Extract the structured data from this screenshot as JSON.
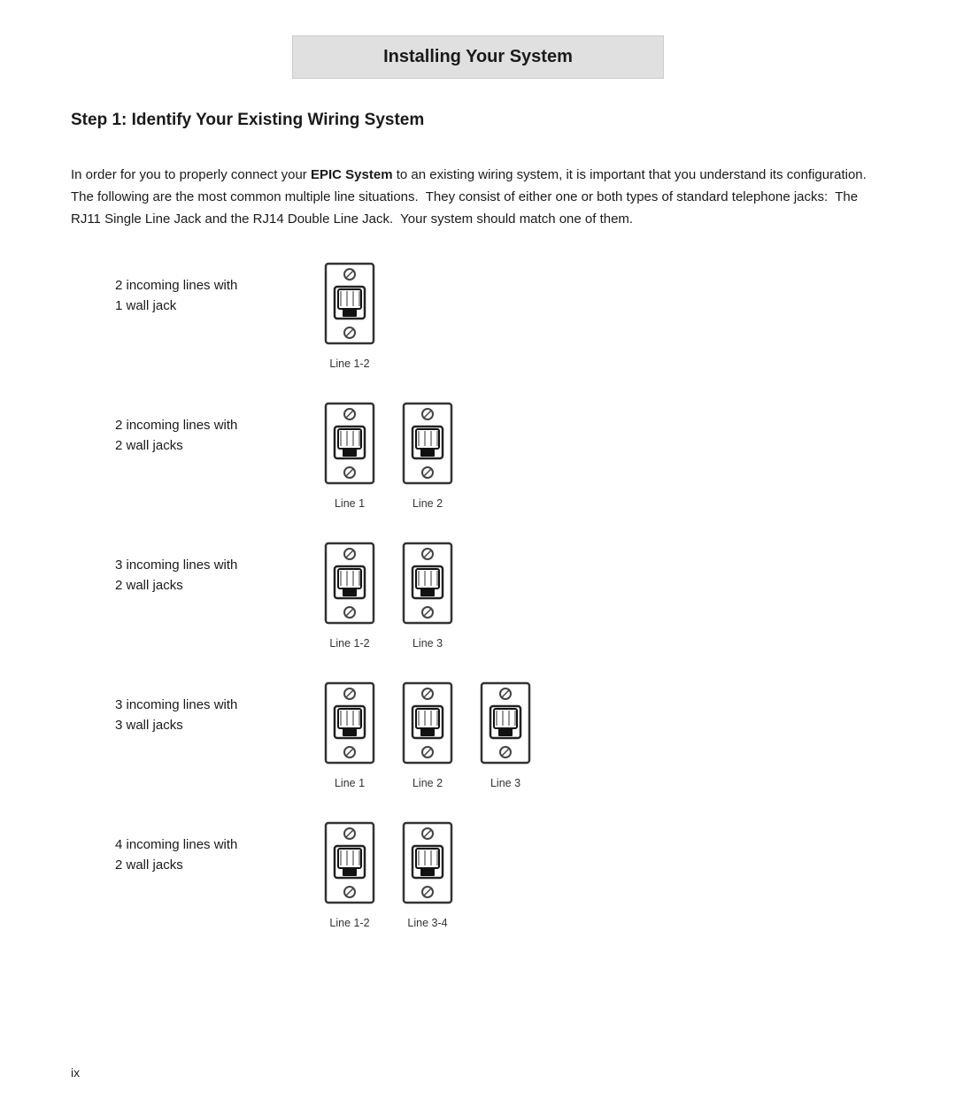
{
  "header": {
    "title": "Installing Your System"
  },
  "step": {
    "heading": "Step 1: Identify Your Existing Wiring System",
    "intro": "In order for you to properly connect your EPIC System to an existing wiring system, it is important that you understand its configuration.  The following are the most common multiple line situations.  They consist of either one or both types of standard telephone jacks:  The RJ11 Single Line Jack and the RJ14 Double Line Jack.  Your system should match one of them.",
    "intro_bold": "EPIC System"
  },
  "wiring_rows": [
    {
      "label": "2 incoming lines with\n1 wall jack",
      "jacks": [
        {
          "label": "Line 1-2",
          "type": "double"
        }
      ]
    },
    {
      "label": "2 incoming lines with\n2 wall jacks",
      "jacks": [
        {
          "label": "Line 1",
          "type": "double"
        },
        {
          "label": "Line 2",
          "type": "double"
        }
      ]
    },
    {
      "label": "3 incoming lines with\n2 wall jacks",
      "jacks": [
        {
          "label": "Line 1-2",
          "type": "double"
        },
        {
          "label": "Line 3",
          "type": "double"
        }
      ]
    },
    {
      "label": "3 incoming lines with\n3 wall jacks",
      "jacks": [
        {
          "label": "Line 1",
          "type": "double"
        },
        {
          "label": "Line 2",
          "type": "double"
        },
        {
          "label": "Line 3",
          "type": "double"
        }
      ]
    },
    {
      "label": "4 incoming lines with\n2 wall jacks",
      "jacks": [
        {
          "label": "Line 1-2",
          "type": "double"
        },
        {
          "label": "Line 3-4",
          "type": "double"
        }
      ]
    }
  ],
  "page_number": "ix"
}
